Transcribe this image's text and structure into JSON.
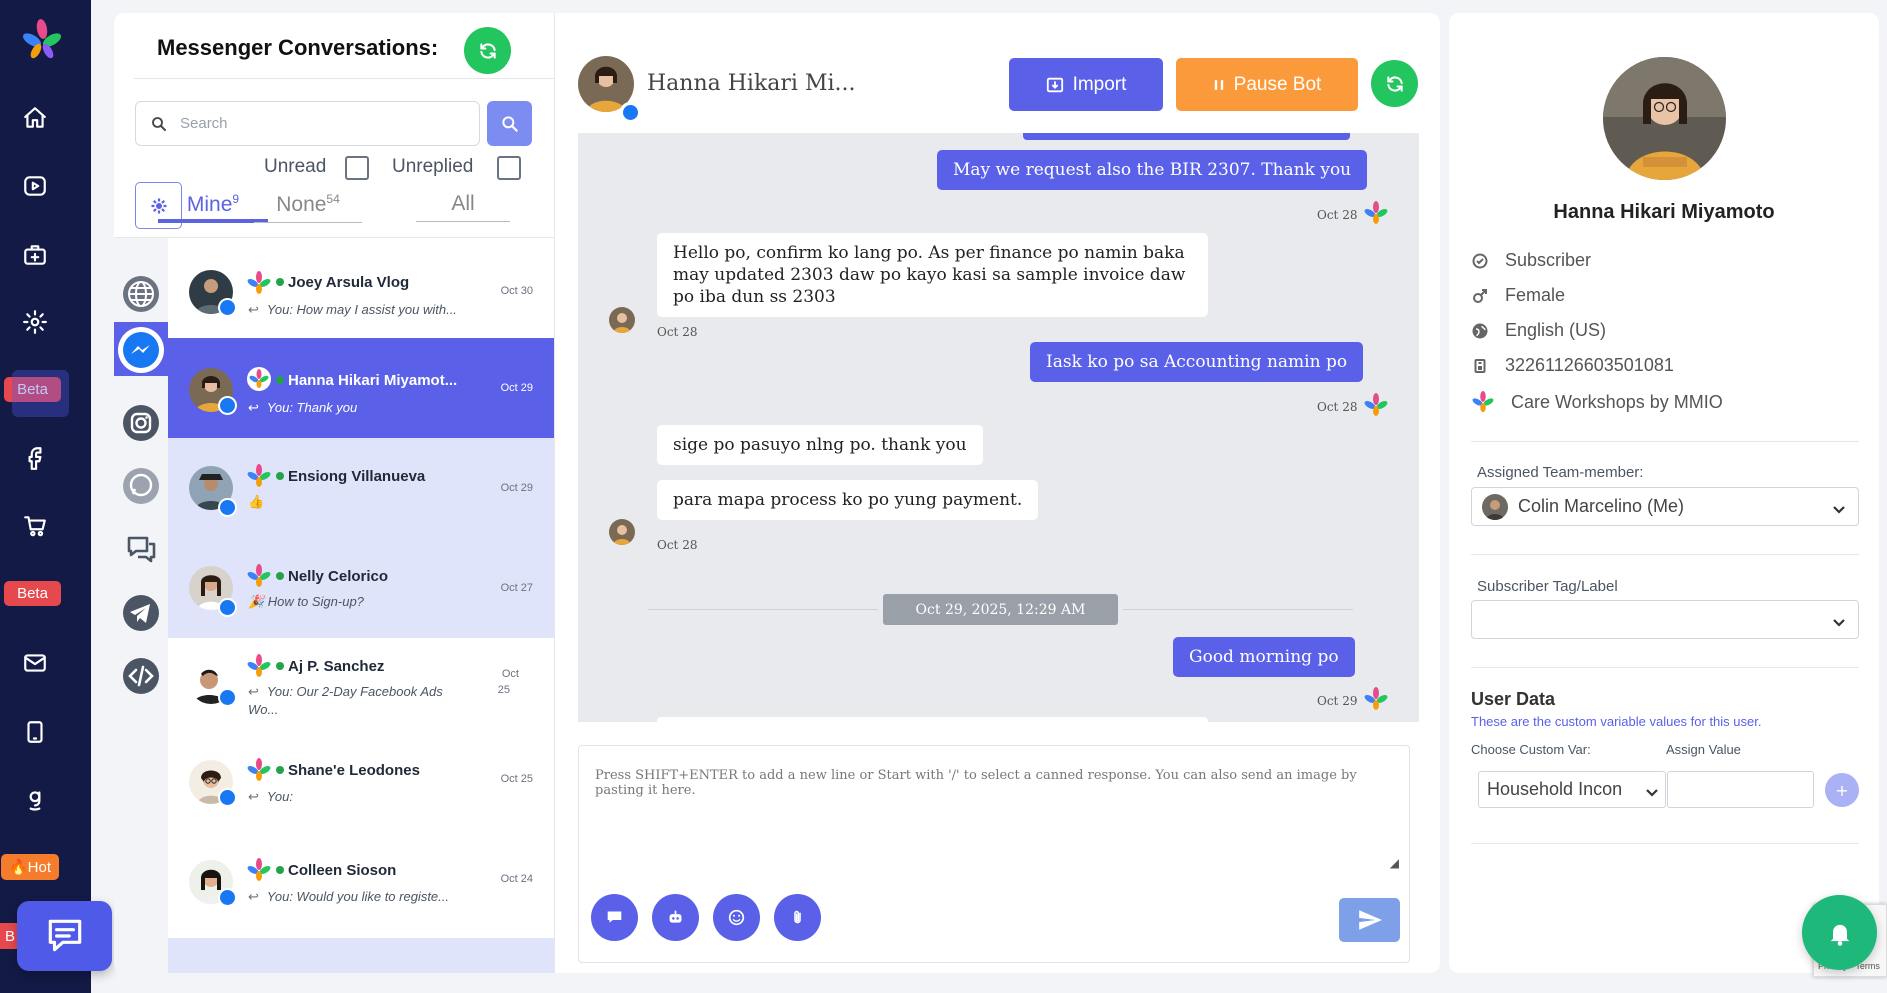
{
  "sidebar": {
    "beta_label": "Beta",
    "hot_label": "Hot",
    "cut_label": "B",
    "icons": [
      "home-icon",
      "video-icon",
      "briefcase-plus-icon",
      "settings-icon",
      "facebook-icon",
      "cart-icon",
      "mail-icon",
      "mobile-icon",
      "google-icon"
    ]
  },
  "conversations": {
    "title": "Messenger Conversations:",
    "search_placeholder": "Search",
    "unread_label": "Unread",
    "unreplied_label": "Unreplied",
    "tabs": [
      {
        "label": "Mine",
        "count": "9"
      },
      {
        "label": "None",
        "count": "54"
      },
      {
        "label": "All",
        "count": ""
      }
    ],
    "channels": [
      "globe-icon",
      "messenger-icon",
      "instagram-icon",
      "whatsapp-icon",
      "chat-icon",
      "telegram-icon",
      "code-icon"
    ],
    "items": [
      {
        "name": "Joey Arsula Vlog",
        "preview": "You:  How may I assist you with...",
        "date": "Oct 30"
      },
      {
        "name": "Hanna Hikari Miyamot...",
        "preview": "You:  Thank you",
        "date": "Oct 29"
      },
      {
        "name": "Ensiong Villanueva",
        "preview": "👍",
        "date": "Oct 29"
      },
      {
        "name": "Nelly Celorico",
        "preview": "🎉 How to Sign-up?",
        "date": "Oct 27"
      },
      {
        "name": "Aj P. Sanchez",
        "preview_line1": "You:  Our 2-Day Facebook Ads",
        "preview_line2": "Wo...",
        "date_line1": "Oct",
        "date_line2": "25"
      },
      {
        "name": "Shane'e Leodones",
        "preview": "You:",
        "date": "Oct 25"
      },
      {
        "name": "Colleen Sioson",
        "preview": "You:  Would you like to registe...",
        "date": "Oct 24"
      }
    ]
  },
  "chat": {
    "contact_name": "Hanna Hikari Mi...",
    "import_label": "Import",
    "pause_label": "Pause Bot",
    "messages": {
      "m1": "May we request also the BIR 2307. Thank you",
      "m1_date": "Oct 28",
      "m2": "Hello po, confirm ko lang po. As per finance po namin baka may updated 2303 daw po kayo kasi sa sample invoice daw po iba dun ss 2303",
      "m2_date": "Oct 28",
      "m3": "Iask ko po sa Accounting namin po",
      "m3_date": "Oct 28",
      "m4": "sige po pasuyo nlng po. thank you",
      "m5": "para mapa process ko po yung payment.",
      "m5_date": "Oct 28",
      "divider": "Oct 29, 2025, 12:29 AM",
      "m6": "Good morning po",
      "m6_date": "Oct 29"
    },
    "composer_placeholder": "Press SHIFT+ENTER to add a new line or Start with '/' to select a canned response. You can also send an image by pasting it here."
  },
  "profile": {
    "name": "Hanna Hikari Miyamoto",
    "type": "Subscriber",
    "gender": "Female",
    "language": "English (US)",
    "id": "32261126603501081",
    "page": "Care Workshops by MMIO",
    "assigned_label": "Assigned Team-member:",
    "assigned_value": "Colin Marcelino (Me)",
    "tag_label": "Subscriber Tag/Label",
    "tag_value": "",
    "user_data_title": "User Data",
    "user_data_desc": "These are the custom variable values for this user.",
    "custom_var_label": "Choose Custom Var:",
    "assign_value_label": "Assign Value",
    "custom_var_value": "Household Incon",
    "add_label": "+",
    "recaptcha_text": "Privacy - Terms"
  },
  "colors": {
    "primary": "#5a61e8",
    "sidebar_bg": "#131a45",
    "success": "#22c55e",
    "warning": "#fa9a3a",
    "danger": "#e5484d"
  }
}
